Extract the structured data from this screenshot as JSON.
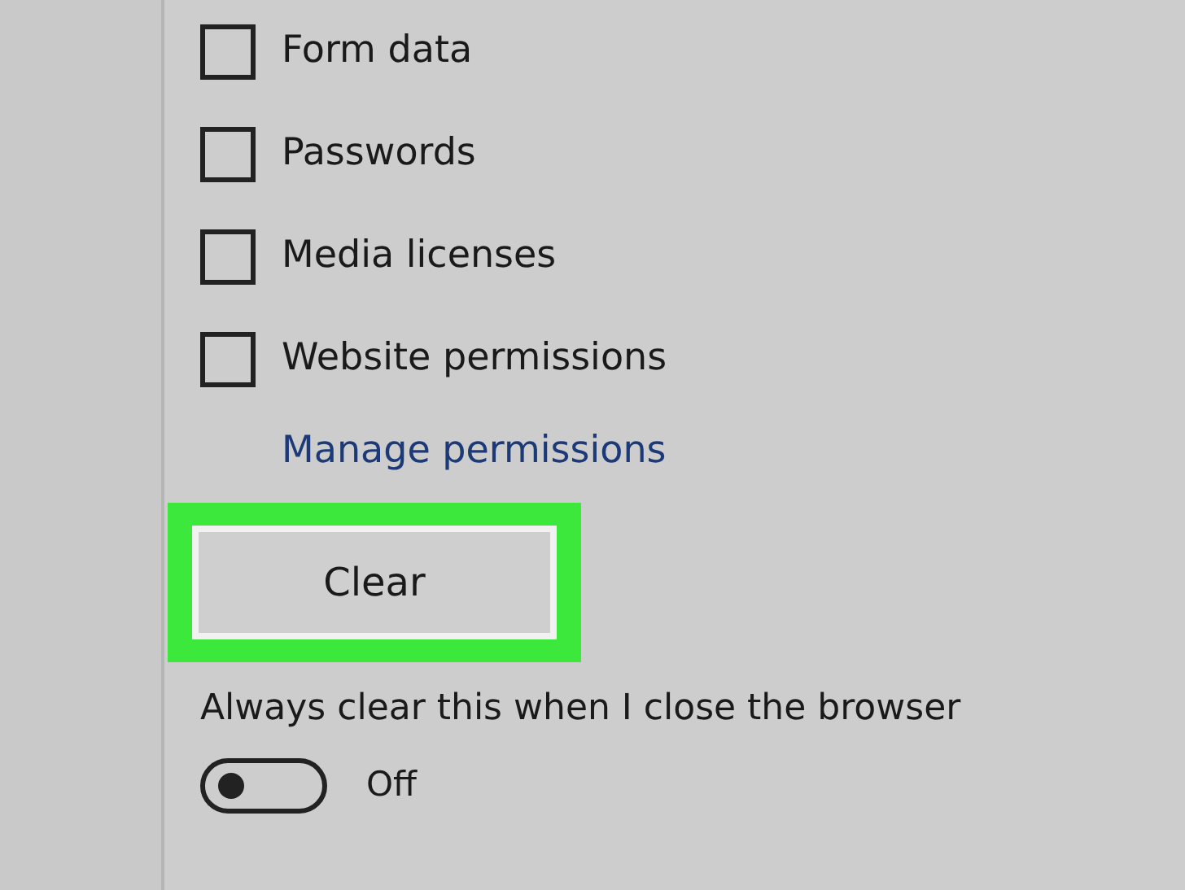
{
  "checkboxes": [
    {
      "label": "Form data",
      "checked": false
    },
    {
      "label": "Passwords",
      "checked": false
    },
    {
      "label": "Media licenses",
      "checked": false
    },
    {
      "label": "Website permissions",
      "checked": false
    }
  ],
  "link": "Manage permissions",
  "clear_button": {
    "label": "Clear",
    "highlighted": true
  },
  "setting": {
    "label": "Always clear this when I close the browser",
    "on": false,
    "state": "Off"
  }
}
